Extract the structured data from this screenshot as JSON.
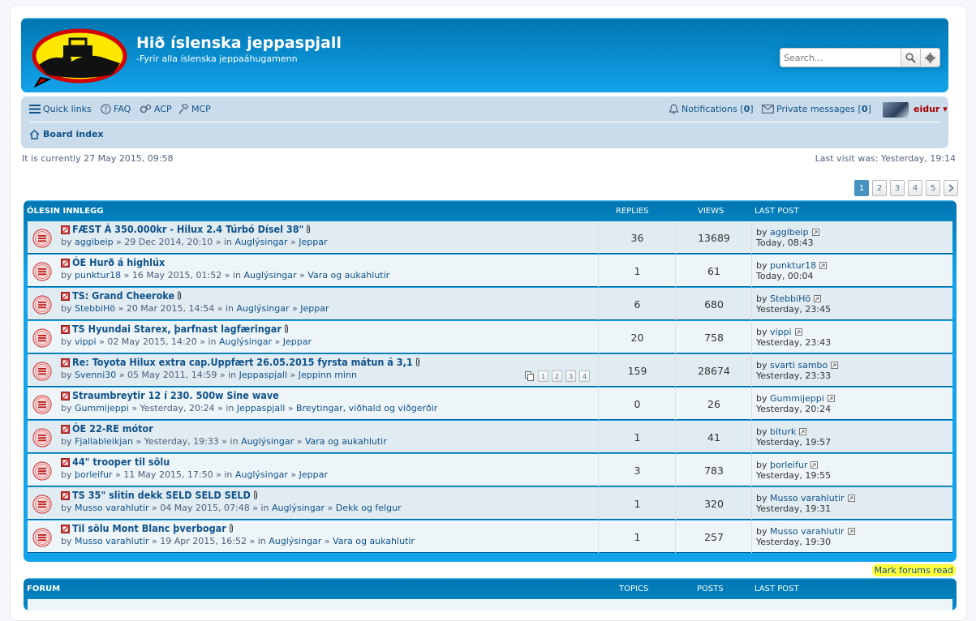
{
  "site": {
    "title": "Hið íslenska jeppaspjall",
    "description": "-Fyrir alla íslenska jeppaáhugamenn",
    "logo_icon": "jeep-speech-bubble-logo"
  },
  "search": {
    "placeholder": "Search…"
  },
  "nav": {
    "quick_links": "Quick links",
    "faq": "FAQ",
    "acp": "ACP",
    "mcp": "MCP",
    "notifications_label": "Notifications [",
    "notifications_count": "0",
    "private_messages_label": "Private messages [",
    "private_messages_count": "0",
    "close_bracket": "]",
    "username": "eidur ▾",
    "board_index": "Board index"
  },
  "status": {
    "current_time": "It is currently 27 May 2015, 09:58",
    "last_visit": "Last visit was: Yesterday, 19:14"
  },
  "pagination": {
    "pages": [
      "1",
      "2",
      "3",
      "4",
      "5"
    ],
    "current": "1",
    "next_icon": "chevron-right-icon"
  },
  "topics_section": {
    "header": "ÓLESIN INNLEGG",
    "col_replies": "REPLIES",
    "col_views": "VIEWS",
    "col_last_post": "LAST POST",
    "topics": [
      {
        "title": "FÆST Á 350.000kr - Hilux 2.4 Túrbó Dísel 38\"",
        "attach": true,
        "by": "by",
        "author": "aggibeip",
        "date": " » 29 Dec 2014, 20:10 » in ",
        "forum1": "Auglýsingar",
        "sep": " » ",
        "forum2": "Jeppar",
        "replies": "36",
        "views": "13689",
        "last_by": "by",
        "last_author": "aggibeip",
        "last_time": "Today, 08:43"
      },
      {
        "title": "ÓE Hurð á highlúx",
        "attach": false,
        "by": "by",
        "author": "punktur18",
        "date": " » 16 May 2015, 01:52 » in ",
        "forum1": "Auglýsingar",
        "sep": " » ",
        "forum2": "Vara og aukahlutir",
        "replies": "1",
        "views": "61",
        "last_by": "by",
        "last_author": "punktur18",
        "last_time": "Today, 00:04"
      },
      {
        "title": "TS: Grand Cheeroke",
        "attach": true,
        "by": "by",
        "author": "StebbiHö",
        "date": " » 20 Mar 2015, 14:54 » in ",
        "forum1": "Auglýsingar",
        "sep": " » ",
        "forum2": "Jeppar",
        "replies": "6",
        "views": "680",
        "last_by": "by",
        "last_author": "StebbiHö",
        "last_time": "Yesterday, 23:45"
      },
      {
        "title": "TS Hyundai Starex, þarfnast lagfæringar",
        "attach": true,
        "by": "by",
        "author": "vippi",
        "date": " » 02 May 2015, 14:20 » in ",
        "forum1": "Auglýsingar",
        "sep": " » ",
        "forum2": "Jeppar",
        "replies": "20",
        "views": "758",
        "last_by": "by",
        "last_author": "vippi",
        "last_time": "Yesterday, 23:43"
      },
      {
        "title": "Re: Toyota Hilux extra cap.Uppfært 26.05.2015 fyrsta mátun á 3,1",
        "attach": true,
        "by": "by",
        "author": "Svenni30",
        "date": " » 05 May 2011, 14:59 » in ",
        "forum1": "Jeppaspjall",
        "sep": " » ",
        "forum2": "Jeppinn minn",
        "pages": [
          "1",
          "2",
          "3",
          "4"
        ],
        "replies": "159",
        "views": "28674",
        "last_by": "by",
        "last_author": "svarti sambo",
        "last_time": "Yesterday, 23:33"
      },
      {
        "title": "Straumbreytir 12 í 230. 500w Sine wave",
        "attach": false,
        "by": "by",
        "author": "Gummijeppi",
        "date": " » Yesterday, 20:24 » in ",
        "forum1": "Jeppaspjall",
        "sep": " » ",
        "forum2": "Breytingar, viðhald og viðgerðir",
        "replies": "0",
        "views": "26",
        "last_by": "by",
        "last_author": "Gummijeppi",
        "last_time": "Yesterday, 20:24"
      },
      {
        "title": "ÓE 22-RE mótor",
        "attach": false,
        "by": "by",
        "author": "Fjallableikjan",
        "date": " » Yesterday, 19:33 » in ",
        "forum1": "Auglýsingar",
        "sep": " » ",
        "forum2": "Vara og aukahlutir",
        "replies": "1",
        "views": "41",
        "last_by": "by",
        "last_author": "biturk",
        "last_time": "Yesterday, 19:57"
      },
      {
        "title": "44\" trooper til sölu",
        "attach": false,
        "by": "by",
        "author": "þorleifur",
        "date": " » 11 May 2015, 17:50 » in ",
        "forum1": "Auglýsingar",
        "sep": " » ",
        "forum2": "Jeppar",
        "replies": "3",
        "views": "783",
        "last_by": "by",
        "last_author": "þorleifur",
        "last_time": "Yesterday, 19:55"
      },
      {
        "title": "TS 35\" slitin dekk SELD SELD SELD",
        "attach": true,
        "by": "by",
        "author": "Musso varahlutir",
        "date": " » 04 May 2015, 07:48 » in ",
        "forum1": "Auglýsingar",
        "sep": " » ",
        "forum2": "Dekk og felgur",
        "replies": "1",
        "views": "320",
        "last_by": "by",
        "last_author": "Musso varahlutir",
        "last_time": "Yesterday, 19:31"
      },
      {
        "title": "Til sölu Mont Blanc þverbogar",
        "attach": true,
        "by": "by",
        "author": "Musso varahlutir",
        "date": " » 19 Apr 2015, 16:52 » in ",
        "forum1": "Auglýsingar",
        "sep": " » ",
        "forum2": "Vara og aukahlutir",
        "replies": "1",
        "views": "257",
        "last_by": "by",
        "last_author": "Musso varahlutir",
        "last_time": "Yesterday, 19:30"
      }
    ]
  },
  "mark_read": "Mark forums read",
  "forum_section": {
    "header": "FORUM",
    "col_topics": "TOPICS",
    "col_posts": "POSTS",
    "col_last_post": "LAST POST"
  },
  "colors": {
    "accent": "#12a3eb",
    "link": "#105289",
    "row_alt1": "#eef5f9",
    "row_alt2": "#e1ebf2",
    "username": "#aa0000",
    "highlight": "#ffff3c"
  }
}
